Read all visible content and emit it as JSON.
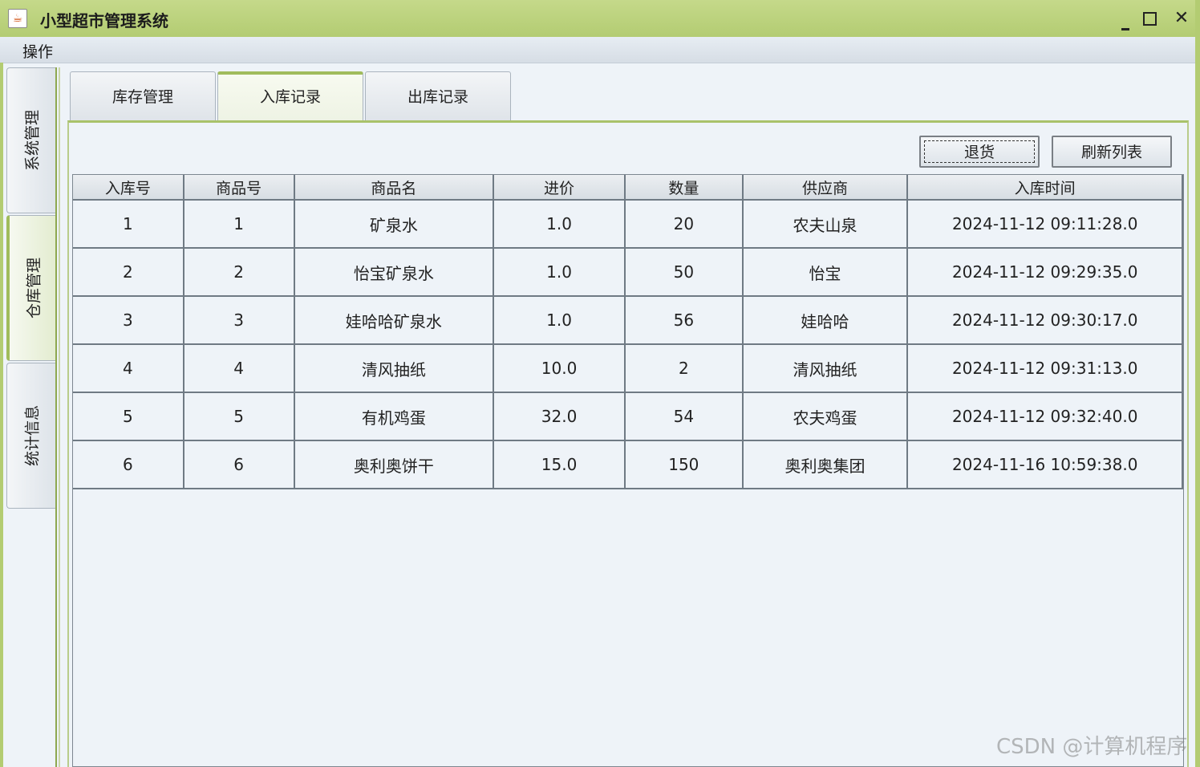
{
  "window": {
    "title": "小型超市管理系统",
    "icon": "java-cup-icon",
    "controls": {
      "minimize": "minimize-icon",
      "maximize": "maximize-icon",
      "close": "✕"
    }
  },
  "menubar": {
    "items": [
      {
        "label": "操作"
      }
    ]
  },
  "side_tabs": [
    {
      "label": "系统管理",
      "active": false
    },
    {
      "label": "仓库管理",
      "active": true
    },
    {
      "label": "统计信息",
      "active": false
    }
  ],
  "tabs": [
    {
      "label": "库存管理",
      "active": false
    },
    {
      "label": "入库记录",
      "active": true
    },
    {
      "label": "出库记录",
      "active": false
    }
  ],
  "toolbar": {
    "return_label": "退货",
    "refresh_label": "刷新列表"
  },
  "table": {
    "columns": [
      "入库号",
      "商品号",
      "商品名",
      "进价",
      "数量",
      "供应商",
      "入库时间"
    ],
    "rows": [
      [
        "1",
        "1",
        "矿泉水",
        "1.0",
        "20",
        "农夫山泉",
        "2024-11-12 09:11:28.0"
      ],
      [
        "2",
        "2",
        "怡宝矿泉水",
        "1.0",
        "50",
        "怡宝",
        "2024-11-12 09:29:35.0"
      ],
      [
        "3",
        "3",
        "娃哈哈矿泉水",
        "1.0",
        "56",
        "娃哈哈",
        "2024-11-12 09:30:17.0"
      ],
      [
        "4",
        "4",
        "清风抽纸",
        "10.0",
        "2",
        "清风抽纸",
        "2024-11-12 09:31:13.0"
      ],
      [
        "5",
        "5",
        "有机鸡蛋",
        "32.0",
        "54",
        "农夫鸡蛋",
        "2024-11-12 09:32:40.0"
      ],
      [
        "6",
        "6",
        "奥利奥饼干",
        "15.0",
        "150",
        "奥利奥集团",
        "2024-11-16 10:59:38.0"
      ]
    ]
  },
  "watermark": "CSDN @计算机程序",
  "colors": {
    "accent": "#b3cc72",
    "active_tab_border": "#a0bc5c",
    "background": "#eef3f8"
  }
}
